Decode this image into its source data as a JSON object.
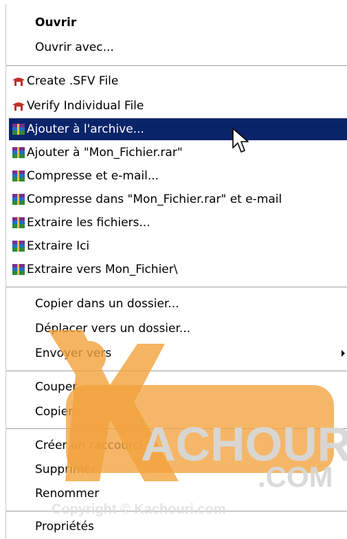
{
  "menu": {
    "items": [
      {
        "label": "Ouvrir",
        "bold": true
      },
      {
        "label": "Ouvrir avec..."
      },
      {
        "label": "Create .SFV File",
        "icon": "sfv-icon"
      },
      {
        "label": "Verify Individual File",
        "icon": "sfv-icon"
      },
      {
        "label": "Ajouter à l'archive...",
        "icon": "winrar-icon",
        "selected": true
      },
      {
        "label": "Ajouter à \"Mon_Fichier.rar\"",
        "icon": "winrar-icon"
      },
      {
        "label": "Compresse et e-mail...",
        "icon": "winrar-icon"
      },
      {
        "label": "Compresse dans \"Mon_Fichier.rar\" et e-mail",
        "icon": "winrar-icon"
      },
      {
        "label": "Extraire les fichiers...",
        "icon": "winrar-icon"
      },
      {
        "label": "Extraire Ici",
        "icon": "winrar-icon"
      },
      {
        "label": "Extraire vers Mon_Fichier\\",
        "icon": "winrar-icon"
      },
      {
        "label": "Copier dans un dossier..."
      },
      {
        "label": "Déplacer vers un dossier..."
      },
      {
        "label": "Envoyer vers",
        "submenu": true
      },
      {
        "label": "Couper"
      },
      {
        "label": "Copier"
      },
      {
        "label": "Créer un raccourci"
      },
      {
        "label": "Supprimer"
      },
      {
        "label": "Renommer"
      },
      {
        "label": "Propriétés"
      }
    ]
  },
  "colors": {
    "selection": "#0a246a",
    "selection_text": "#ffffff",
    "watermark_orange": "#f2a23c"
  },
  "watermark": {
    "brand": "ACHOURI",
    "brand_initial": "K",
    "tld": ".COM",
    "copyright": "Copyright © Kachouri.com"
  }
}
